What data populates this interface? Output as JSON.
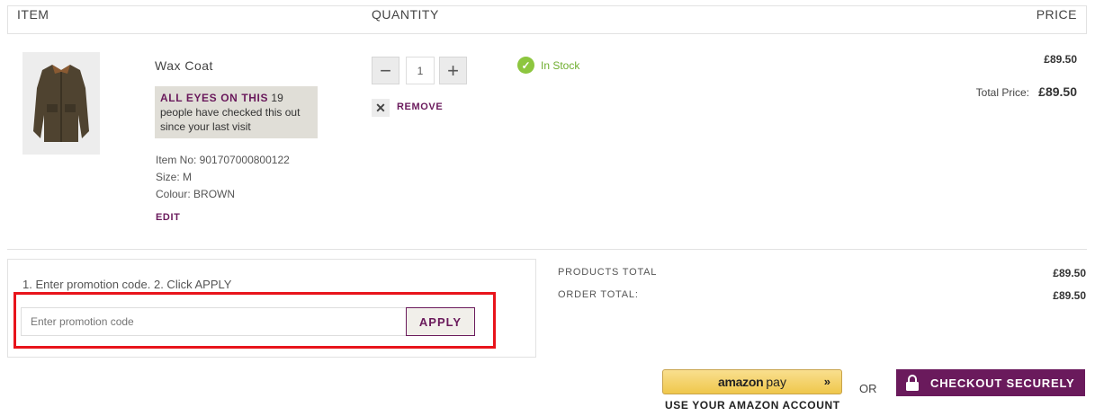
{
  "header": {
    "item": "ITEM",
    "quantity": "QUANTITY",
    "price": "PRICE"
  },
  "product": {
    "name": "Wax Coat",
    "promo_title": "ALL EYES ON THIS",
    "promo_text": "19 people have checked this out since your last visit",
    "item_no": "Item No: 901707000800122",
    "size": "Size: M",
    "colour": "Colour: BROWN",
    "edit_label": "EDIT",
    "quantity": "1",
    "remove_label": "REMOVE",
    "stock": "In Stock",
    "price": "£89.50",
    "total_price_label": "Total Price:",
    "total_price": "£89.50"
  },
  "promo": {
    "instructions": "1. Enter promotion code. 2. Click APPLY",
    "placeholder": "Enter promotion code",
    "apply_label": "APPLY"
  },
  "totals": {
    "products_label": "PRODUCTS TOTAL",
    "products_value": "£89.50",
    "order_label": "ORDER TOTAL:",
    "order_value": "£89.50"
  },
  "checkout": {
    "amazon_word": "amazon",
    "amazon_pay": "pay",
    "amazon_sub": "USE YOUR AMAZON ACCOUNT",
    "or": "OR",
    "checkout_label": "CHECKOUT SECURELY"
  },
  "colors": {
    "accent": "#6a1a5c",
    "stock": "#8dc63f",
    "highlight": "#e8141b"
  }
}
